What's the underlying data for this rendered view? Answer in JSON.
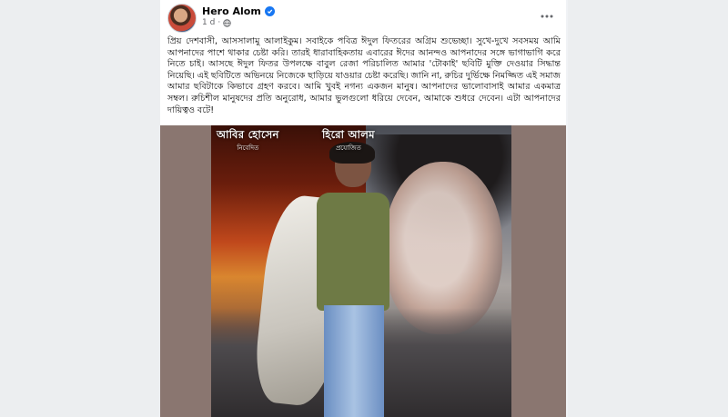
{
  "post": {
    "author": "Hero Alom",
    "time": "1 d",
    "text": "প্রিয় দেশবাসী, আসসালামু আলাইকুম। সবাইকে পবিত্র ঈদুল ফিতরের অগ্রিম শুভেচ্ছা। সুখে-দুখে সবসময় আমি আপনাদের পাশে থাকার চেষ্টা করি। তারই ধারাবাহিকতায় এবারের ঈদের আনন্দও আপনাদের সঙ্গে ভাগাভাগি করে নিতে চাই। আসছে ঈদুল ফিতর উপলক্ষে বাবুল রেজা পরিচালিত আমার 'টোকাই' ছবিটি মুক্তি দেওয়ার সিদ্ধান্ত নিয়েছি। এই ছবিটিতে অভিনয়ে নিজেকে ছাড়িয়ে যাওয়ার চেষ্টা করেছি। জানি না, রুচির দুর্ভিক্ষে নিমজ্জিত এই সমাজ আমার ছবিটাকে কিভাবে গ্রহণ করবে। আমি খুবই নগন্য একজন মানুষ। আপনাদের ভালোবাসাই আমার একমাত্র সম্বল। রুচিশীল মানুষদের প্রতি অনুরোধ, আমার ভুলগুলো ধরিয়ে দেবেন, আমাকে শুধরে দেবেন। এটা আপনাদের দায়িত্বও বটে!"
  },
  "poster": {
    "credit_left_name": "আবির হোসেন",
    "credit_left_role": "নিবেদিত",
    "credit_right_name": "হিরো আলম",
    "credit_right_role": "প্রযোজিত"
  },
  "colors": {
    "verified_badge": "#1877f2",
    "meta_text": "#65676b",
    "page_bg": "#f0f2f5"
  },
  "icons": {
    "verified": "verified-badge-icon",
    "audience": "globe-icon",
    "menu": "more-options-icon"
  }
}
